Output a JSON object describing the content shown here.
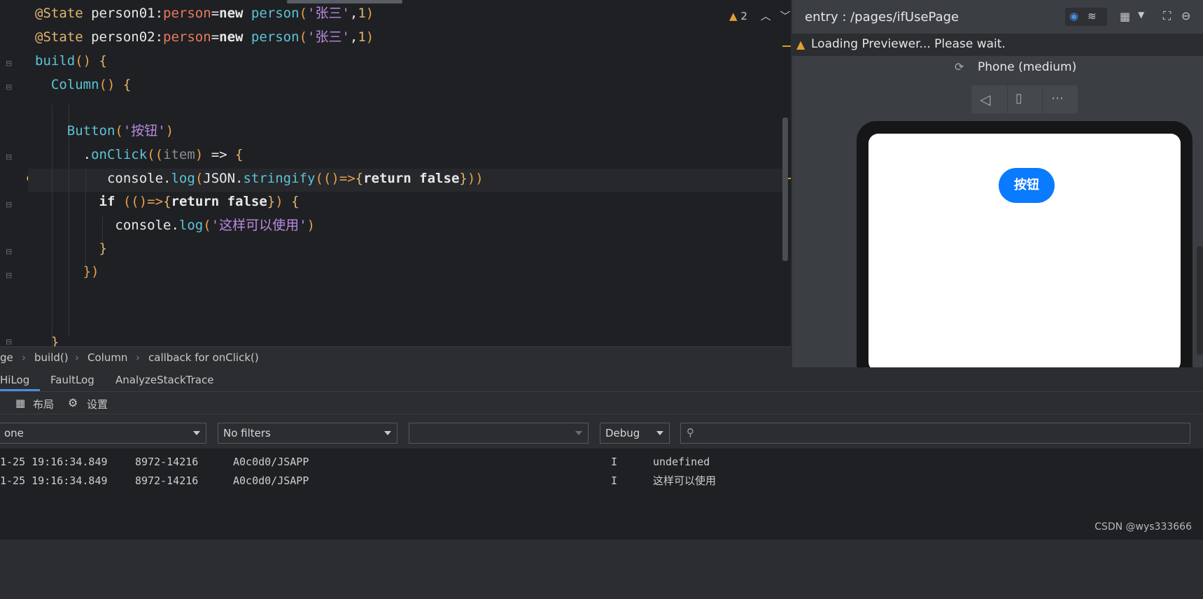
{
  "editor": {
    "lines": [
      {
        "segments": [
          [
            "@State ",
            "kw-anno"
          ],
          [
            "person01",
            "kw-var"
          ],
          [
            ":",
            "kw-op"
          ],
          [
            "person",
            "kw-type"
          ],
          [
            "=",
            "kw-op"
          ],
          [
            "new ",
            "kw-new"
          ],
          [
            "person",
            "kw-fn"
          ],
          [
            "(",
            "kw-paren"
          ],
          [
            "'张三'",
            "kw-str"
          ],
          [
            ",",
            "kw-op"
          ],
          [
            "1",
            "kw-num"
          ],
          [
            ")",
            "kw-paren"
          ]
        ]
      },
      {
        "segments": [
          [
            "@State ",
            "kw-anno"
          ],
          [
            "person02",
            "kw-var"
          ],
          [
            ":",
            "kw-op"
          ],
          [
            "person",
            "kw-type"
          ],
          [
            "=",
            "kw-op"
          ],
          [
            "new ",
            "kw-new"
          ],
          [
            "person",
            "kw-fn"
          ],
          [
            "(",
            "kw-paren"
          ],
          [
            "'张三'",
            "kw-str"
          ],
          [
            ",",
            "kw-op"
          ],
          [
            "1",
            "kw-num"
          ],
          [
            ")",
            "kw-paren"
          ]
        ]
      },
      {
        "segments": [
          [
            "build",
            "kw-fn"
          ],
          [
            "() ",
            "kw-paren"
          ],
          [
            "{",
            "kw-brace"
          ]
        ]
      },
      {
        "segments": [
          [
            "  Column",
            "kw-fn"
          ],
          [
            "() ",
            "kw-paren"
          ],
          [
            "{",
            "kw-brace"
          ]
        ]
      },
      {
        "segments": [
          [
            "",
            "kw-op"
          ]
        ]
      },
      {
        "segments": [
          [
            "    Button",
            "kw-fn"
          ],
          [
            "(",
            "kw-paren"
          ],
          [
            "'按钮'",
            "kw-str"
          ],
          [
            ")",
            "kw-paren"
          ]
        ]
      },
      {
        "segments": [
          [
            "      .",
            "kw-op"
          ],
          [
            "onClick",
            "kw-method"
          ],
          [
            "((",
            "kw-paren"
          ],
          [
            "item",
            "kw-param"
          ],
          [
            ") ",
            "kw-paren"
          ],
          [
            "=> ",
            "kw-op"
          ],
          [
            "{",
            "kw-brace"
          ]
        ]
      },
      {
        "segments": [
          [
            "         console",
            "kw-var"
          ],
          [
            ".",
            "kw-op"
          ],
          [
            "log",
            "kw-method"
          ],
          [
            "(",
            "kw-paren"
          ],
          [
            "JSON",
            "kw-var"
          ],
          [
            ".",
            "kw-op"
          ],
          [
            "stringify",
            "kw-method"
          ],
          [
            "((",
            "kw-paren"
          ],
          [
            ")=>",
            "kw-paren"
          ],
          [
            "{",
            "kw-brace"
          ],
          [
            "return false",
            "kw-bold"
          ],
          [
            "}",
            "kw-brace"
          ],
          [
            "))",
            "kw-paren"
          ]
        ]
      },
      {
        "segments": [
          [
            "        if ",
            "kw-bold"
          ],
          [
            "((",
            "kw-paren"
          ],
          [
            ")=>",
            "kw-paren"
          ],
          [
            "{",
            "kw-brace"
          ],
          [
            "return false",
            "kw-bold"
          ],
          [
            "}",
            "kw-brace"
          ],
          [
            ") ",
            "kw-paren"
          ],
          [
            "{",
            "kw-brace"
          ]
        ]
      },
      {
        "segments": [
          [
            "          console",
            "kw-var"
          ],
          [
            ".",
            "kw-op"
          ],
          [
            "log",
            "kw-method"
          ],
          [
            "(",
            "kw-paren"
          ],
          [
            "'这样可以使用'",
            "kw-str"
          ],
          [
            ")",
            "kw-paren"
          ]
        ]
      },
      {
        "segments": [
          [
            "        }",
            "kw-brace"
          ]
        ]
      },
      {
        "segments": [
          [
            "      })",
            "kw-paren"
          ]
        ]
      },
      {
        "segments": [
          [
            "",
            "kw-op"
          ]
        ]
      },
      {
        "segments": [
          [
            "",
            "kw-op"
          ]
        ]
      },
      {
        "segments": [
          [
            "  }",
            "kw-brace"
          ]
        ]
      }
    ],
    "warning_count": "2"
  },
  "breadcrumb": {
    "items": [
      "ge",
      "build()",
      "Column",
      "callback for onClick()"
    ]
  },
  "previewer": {
    "title": "entry : /pages/ifUsePage",
    "loading": "Loading Previewer... Please wait.",
    "device": "Phone (medium)",
    "button_label": "按钮"
  },
  "bottom": {
    "tabs": [
      "HiLog",
      "FaultLog",
      "AnalyzeStackTrace"
    ],
    "toolbar": {
      "layout": "布局",
      "settings": "设置"
    },
    "filters": {
      "device": "one",
      "filter": "No filters",
      "process": "",
      "level": "Debug",
      "search_placeholder": ""
    },
    "log_rows": [
      {
        "time": "1-25 19:16:34.849",
        "pid": "8972-14216",
        "tag": "A0c0d0/JSAPP",
        "level": "I",
        "msg": "undefined"
      },
      {
        "time": "1-25 19:16:34.849",
        "pid": "8972-14216",
        "tag": "A0c0d0/JSAPP",
        "level": "I",
        "msg": "这样可以使用"
      }
    ]
  },
  "watermark": "CSDN @wys333666"
}
